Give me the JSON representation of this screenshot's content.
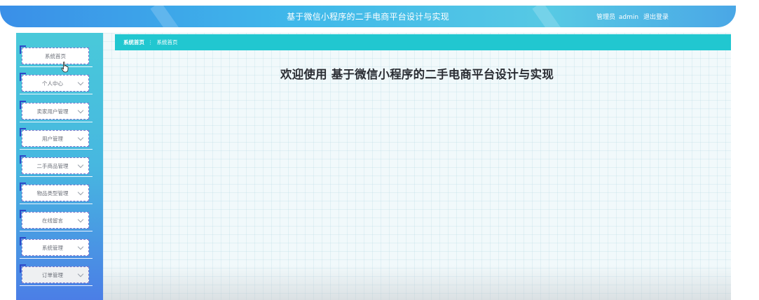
{
  "header": {
    "title": "基于微信小程序的二手电商平台设计与实现",
    "role_label": "管理员",
    "username": "admin",
    "logout_label": "退出登录"
  },
  "sidebar": {
    "items": [
      {
        "label": "系统首页",
        "has_chevron": false
      },
      {
        "label": "个人中心",
        "has_chevron": true
      },
      {
        "label": "卖家用户管理",
        "has_chevron": true
      },
      {
        "label": "用户管理",
        "has_chevron": true
      },
      {
        "label": "二手商品管理",
        "has_chevron": true
      },
      {
        "label": "物品类型管理",
        "has_chevron": true
      },
      {
        "label": "在线留言",
        "has_chevron": true
      },
      {
        "label": "系统管理",
        "has_chevron": true
      },
      {
        "label": "订单管理",
        "has_chevron": true
      }
    ]
  },
  "breadcrumb": {
    "home": "系统首页",
    "separator": "⋮",
    "current": "系统首页"
  },
  "main": {
    "welcome": "欢迎使用 基于微信小程序的二手电商平台设计与实现"
  },
  "colors": {
    "header_start": "#3a8fe8",
    "header_end": "#57c9e4",
    "breadcrumb_bg": "#21c7d0",
    "sidebar_top": "#49c9da",
    "sidebar_bottom": "#4b7ee6",
    "menu_corner": "#2d48c8"
  }
}
